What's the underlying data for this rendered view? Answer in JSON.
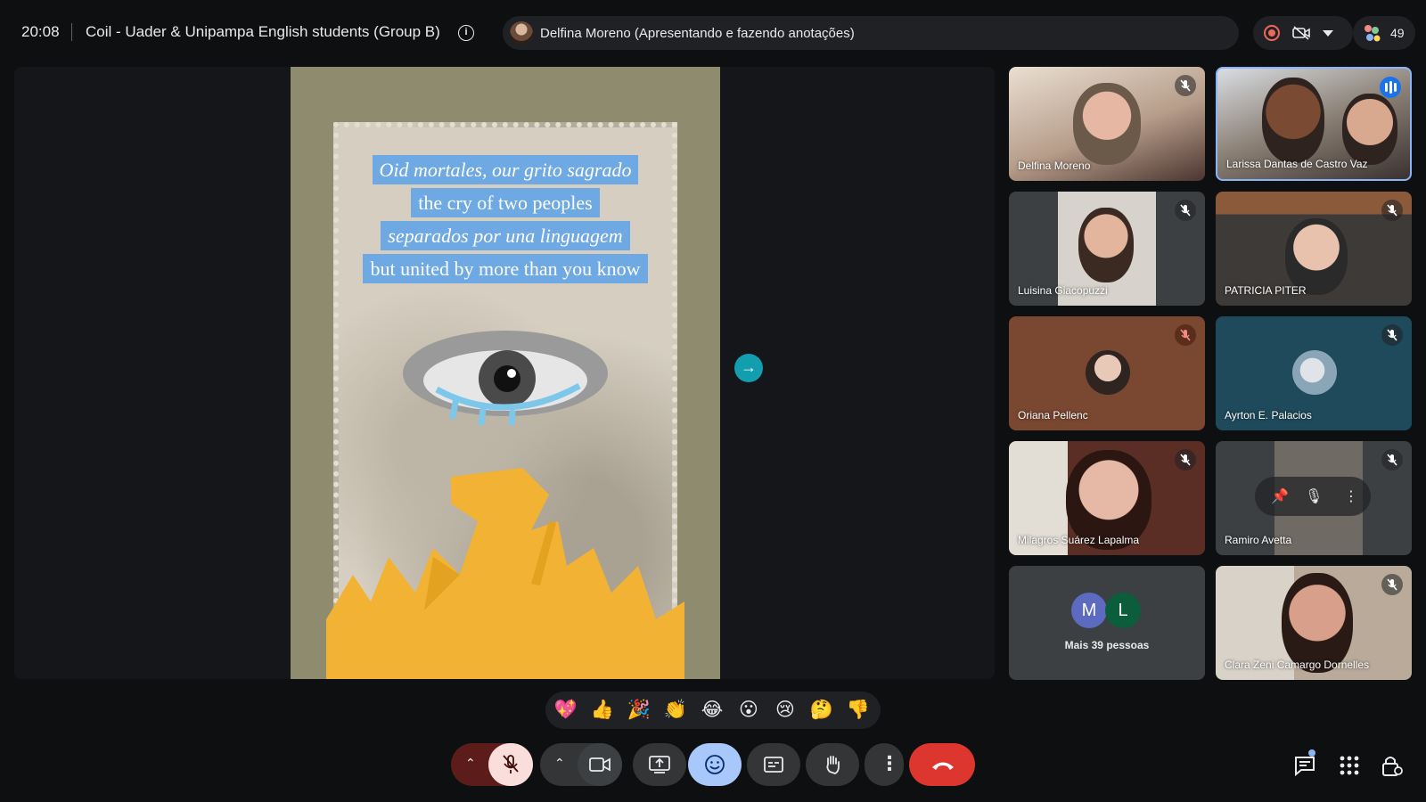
{
  "topbar": {
    "time": "20:08",
    "meeting_title": "Coil - Uader & Unipampa English students (Group B)",
    "presenter_status": "Delfina Moreno (Apresentando e fazendo anotações)",
    "participant_count": "49",
    "icons": [
      "info-icon",
      "recording-icon",
      "camera-off-icon",
      "caret-down-icon",
      "people-icon"
    ]
  },
  "slide": {
    "lines": [
      "Oid mortales, our grito sagrado",
      "the cry of two peoples",
      "separados por una linguagem",
      "but united by more than you know"
    ],
    "colors": {
      "highlight": "#6fa9e3",
      "background": "#8f8b6f",
      "flames": "#f2b233"
    }
  },
  "participants": [
    {
      "name": "Delfina Moreno",
      "muted": true
    },
    {
      "name": "Larissa Dantas de Castro Vaz",
      "muted": false,
      "speaking": true
    },
    {
      "name": "Luisina Giacopuzzi",
      "muted": true
    },
    {
      "name": "PATRICIA PITER",
      "muted": true
    },
    {
      "name": "Oriana Pellenc",
      "muted": true
    },
    {
      "name": "Ayrton E. Palacios",
      "muted": true
    },
    {
      "name": "Milagros Suárez Lapalma",
      "muted": true
    },
    {
      "name": "Ramiro Avetta",
      "muted": true
    },
    {
      "name": "Clara Zeni Camargo Dornelles",
      "muted": true
    }
  ],
  "more_people": {
    "label": "Mais 39 pessoas",
    "avatars": [
      {
        "initial": "M",
        "color": "#5c6bc0"
      },
      {
        "initial": "L",
        "color": "#0b5d3b"
      }
    ]
  },
  "reactions": [
    "💖",
    "👍",
    "🎉",
    "👏",
    "😂",
    "😮",
    "😢",
    "🤔",
    "👎"
  ],
  "controls": {
    "icons": [
      "chevron-up-icon",
      "mic-off-icon",
      "camera-icon",
      "present-screen-icon",
      "emoji-icon",
      "captions-icon",
      "raise-hand-icon",
      "more-vert-icon",
      "hang-up-icon",
      "chat-icon",
      "apps-icon",
      "host-controls-icon"
    ],
    "colors": {
      "leave": "#dc362e",
      "active": "#a8c7fa",
      "mic_off": "#f9dedc"
    }
  }
}
